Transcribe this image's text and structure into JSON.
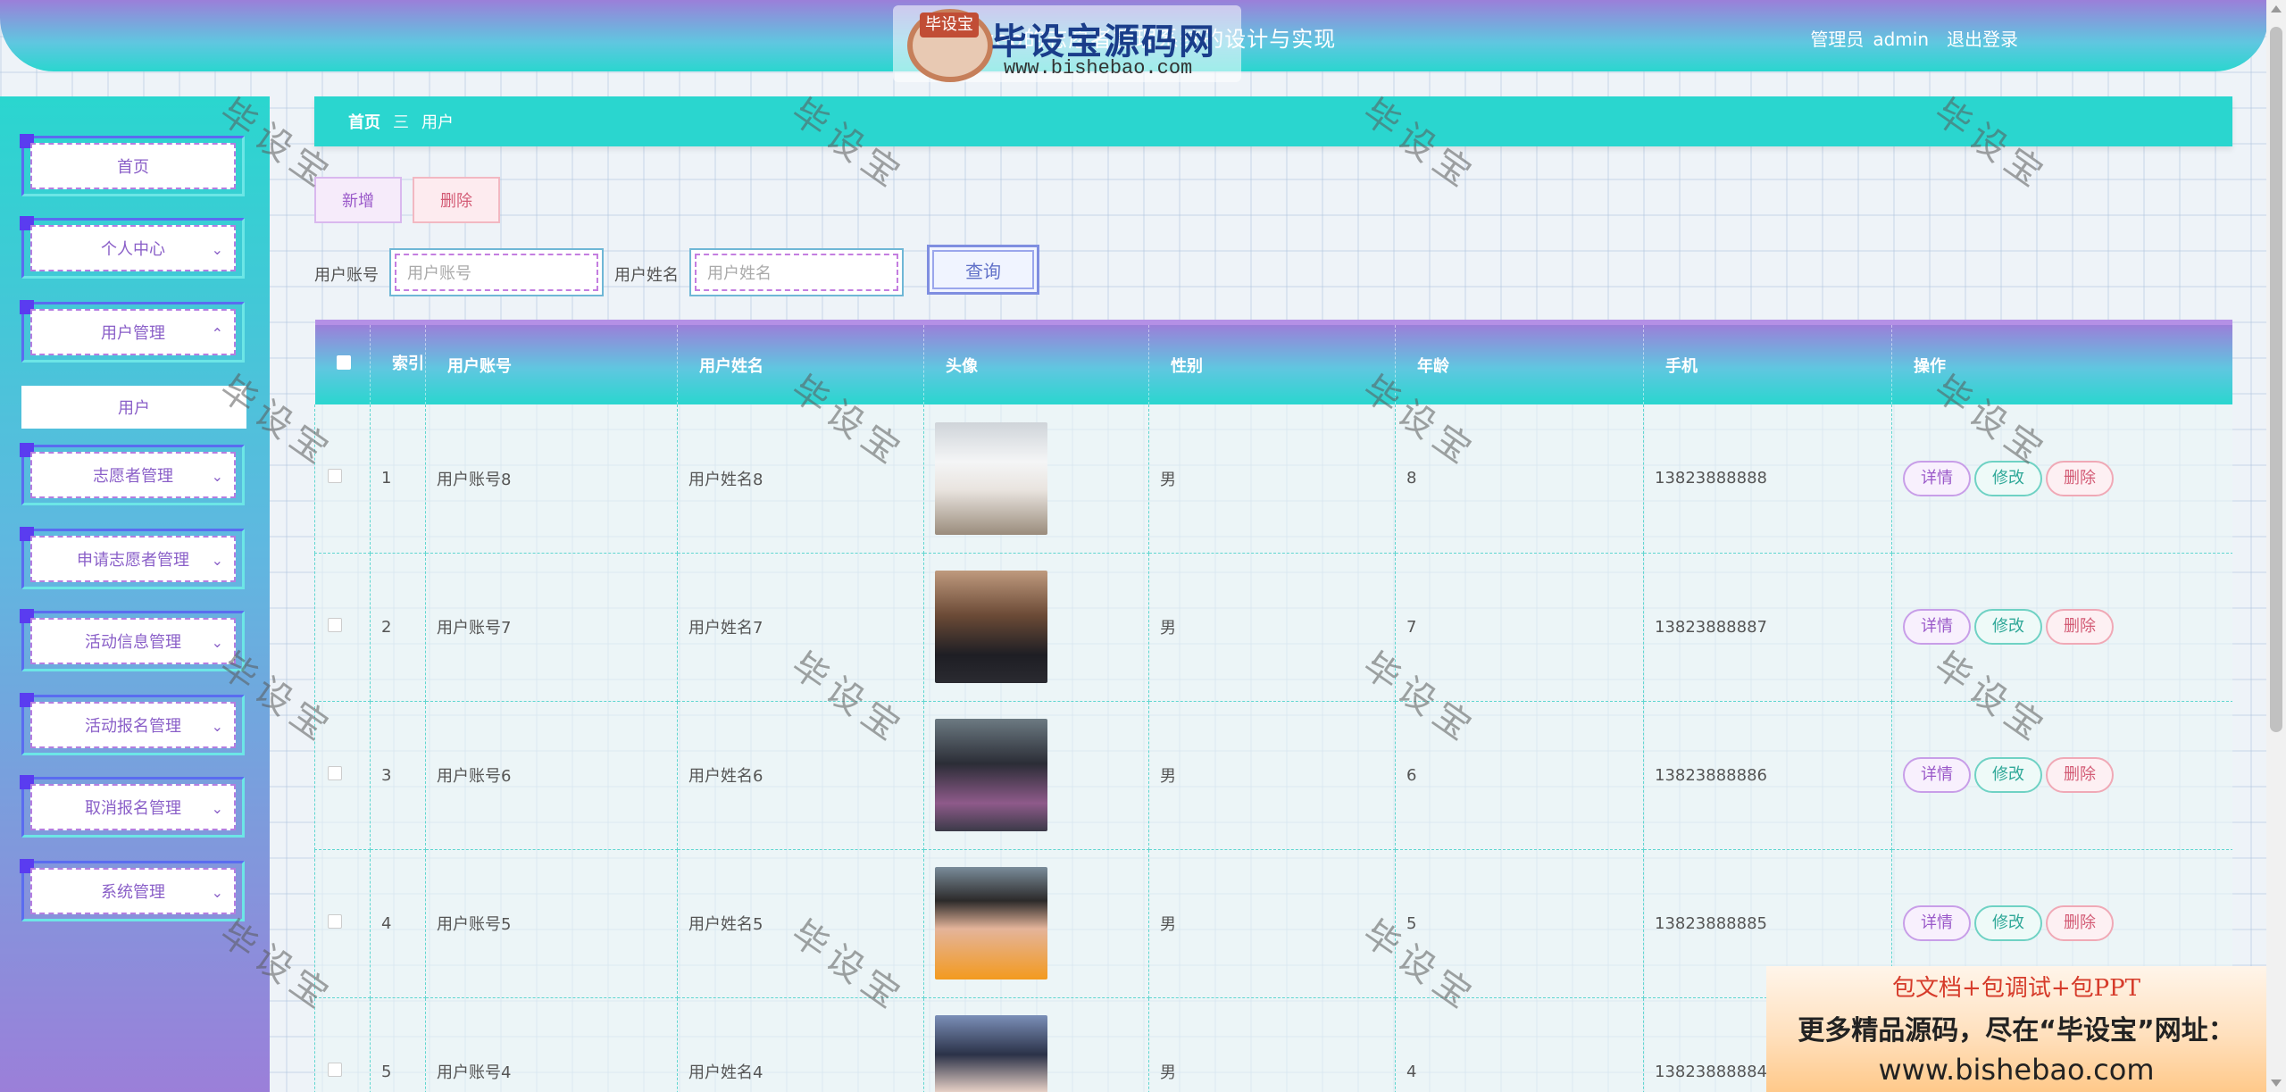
{
  "header": {
    "title": "基于web的志愿者管理系统的设计与实现",
    "user_role": "管理员",
    "user_name": "admin",
    "logout_label": "退出登录"
  },
  "watermark": {
    "badge": "毕设宝",
    "brand": "毕设宝源码网",
    "url": "www.bishebao.com",
    "diagonal_text": "毕设宝"
  },
  "sidebar": {
    "items": [
      {
        "label": "首页",
        "has_arrow": false
      },
      {
        "label": "个人中心",
        "has_arrow": true,
        "arrow": "⌄"
      },
      {
        "label": "用户管理",
        "has_arrow": true,
        "arrow": "⌃"
      },
      {
        "label": "志愿者管理",
        "has_arrow": true,
        "arrow": "⌄"
      },
      {
        "label": "申请志愿者管理",
        "has_arrow": true,
        "arrow": "⌄"
      },
      {
        "label": "活动信息管理",
        "has_arrow": true,
        "arrow": "⌄"
      },
      {
        "label": "活动报名管理",
        "has_arrow": true,
        "arrow": "⌄"
      },
      {
        "label": "取消报名管理",
        "has_arrow": true,
        "arrow": "⌄"
      },
      {
        "label": "系统管理",
        "has_arrow": true,
        "arrow": "⌄"
      }
    ],
    "submenu_active": "用户"
  },
  "breadcrumb": {
    "home": "首页",
    "separator": "三",
    "current": "用户"
  },
  "actions": {
    "add_label": "新增",
    "delete_label": "删除"
  },
  "search": {
    "account_label": "用户账号",
    "account_placeholder": "用户账号",
    "name_label": "用户姓名",
    "name_placeholder": "用户姓名",
    "query_label": "查询"
  },
  "table": {
    "headers": [
      "",
      "索引",
      "用户账号",
      "用户姓名",
      "头像",
      "性别",
      "年龄",
      "手机",
      "操作"
    ],
    "rows": [
      {
        "index": "1",
        "account": "用户账号8",
        "name": "用户姓名8",
        "avatar": "avatar-photo",
        "gender": "男",
        "age": "8",
        "phone": "13823888888"
      },
      {
        "index": "2",
        "account": "用户账号7",
        "name": "用户姓名7",
        "avatar": "avatar-photo",
        "gender": "男",
        "age": "7",
        "phone": "13823888887"
      },
      {
        "index": "3",
        "account": "用户账号6",
        "name": "用户姓名6",
        "avatar": "avatar-photo",
        "gender": "男",
        "age": "6",
        "phone": "13823888886"
      },
      {
        "index": "4",
        "account": "用户账号5",
        "name": "用户姓名5",
        "avatar": "avatar-photo",
        "gender": "男",
        "age": "5",
        "phone": "13823888885"
      },
      {
        "index": "5",
        "account": "用户账号4",
        "name": "用户姓名4",
        "avatar": "avatar-photo",
        "gender": "男",
        "age": "4",
        "phone": "13823888884"
      }
    ],
    "row_actions": {
      "detail": "详情",
      "edit": "修改",
      "delete": "删除"
    }
  },
  "promo": {
    "line1": "包文档+包调试+包PPT",
    "line2": "更多精品源码，尽在“毕设宝”网址：",
    "line3": "www.bishebao.com"
  },
  "colors": {
    "accent_teal": "#2ad6cf",
    "accent_purple": "#9b7fd9",
    "detail": "#9a59c9",
    "edit": "#2fa898",
    "delete": "#d35b75"
  }
}
